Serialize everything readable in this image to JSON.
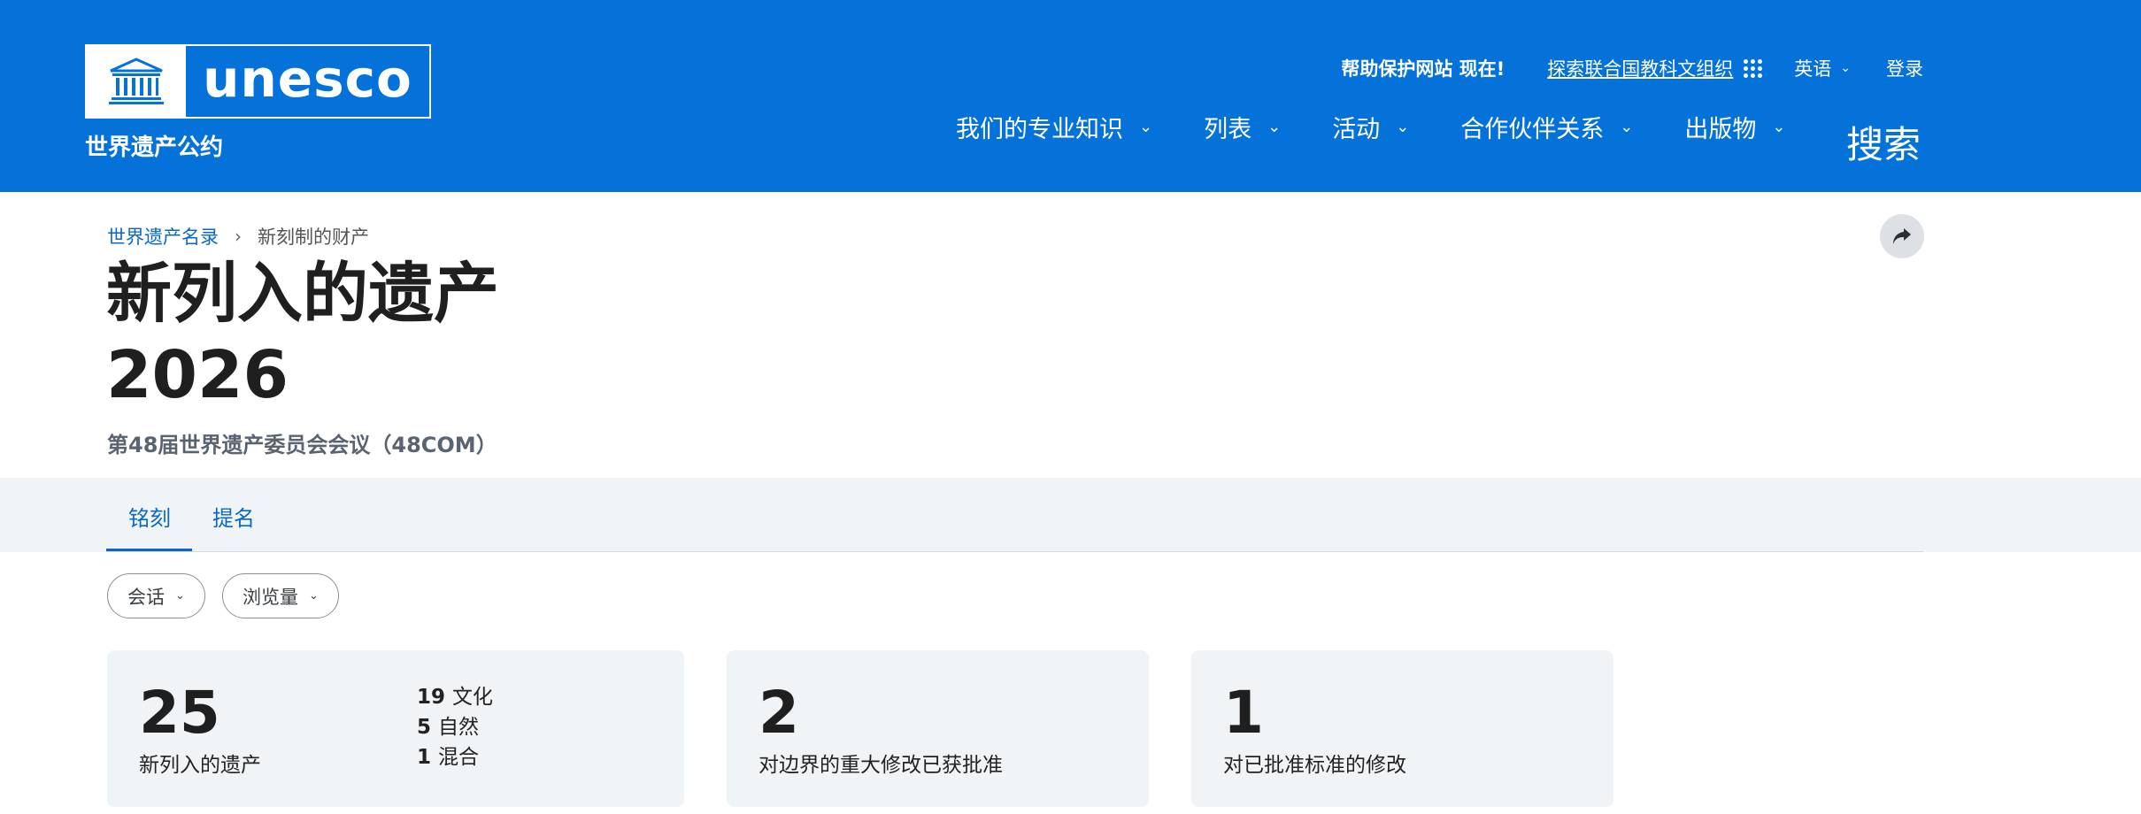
{
  "header": {
    "logo_text": "unesco",
    "subtitle": "世界遗产公约",
    "help_text": "帮助保护网站 现在!",
    "explore_link": "探索联合国教科文组织",
    "language": "英语",
    "login": "登录",
    "brand_color": "#0472d8"
  },
  "nav": {
    "items": [
      {
        "label": "我们的专业知识"
      },
      {
        "label": "列表"
      },
      {
        "label": "活动"
      },
      {
        "label": "合作伙伴关系"
      },
      {
        "label": "出版物"
      }
    ],
    "search": "搜索"
  },
  "breadcrumb": {
    "parent": "世界遗产名录",
    "current": "新刻制的财产"
  },
  "page": {
    "title_line1": "新列入的遗产",
    "title_line2": "2026",
    "subtitle": "第48届世界遗产委员会会议（48COM）"
  },
  "tabs": [
    {
      "label": "铭刻",
      "active": true
    },
    {
      "label": "提名",
      "active": false
    }
  ],
  "filters": [
    {
      "label": "会话"
    },
    {
      "label": "浏览量"
    }
  ],
  "stats": {
    "inscribed": {
      "value": "25",
      "label": "新列入的遗产",
      "breakdown": [
        {
          "num": "19",
          "label": "文化"
        },
        {
          "num": "5",
          "label": "自然"
        },
        {
          "num": "1",
          "label": "混合"
        }
      ]
    },
    "boundary": {
      "value": "2",
      "label": "对边界的重大修改已获批准"
    },
    "criteria": {
      "value": "1",
      "label": "对已批准标准的修改"
    }
  }
}
